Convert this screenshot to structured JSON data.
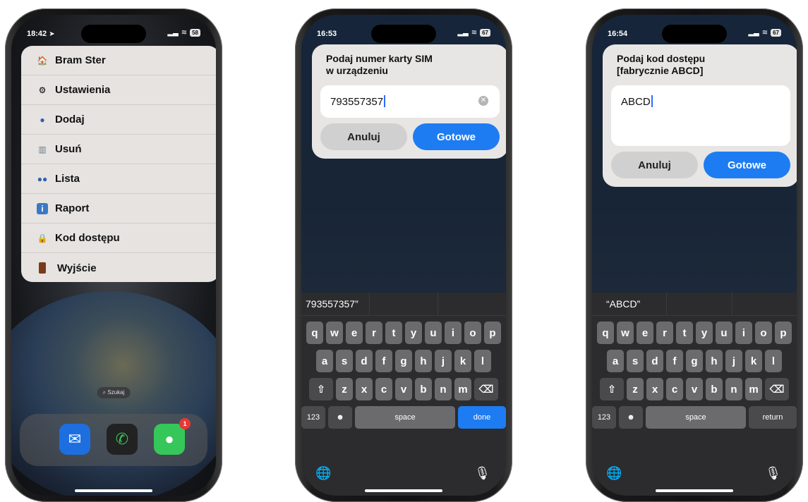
{
  "phones": [
    {
      "status": {
        "time": "18:42",
        "battery": "58"
      },
      "menu": [
        {
          "label": "Bram Ster",
          "icon": "house-icon"
        },
        {
          "label": "Ustawienia",
          "icon": "gear-icon"
        },
        {
          "label": "Dodaj",
          "icon": "person-icon"
        },
        {
          "label": "Usuń",
          "icon": "trash-icon"
        },
        {
          "label": "Lista",
          "icon": "people-icon"
        },
        {
          "label": "Raport",
          "icon": "info-icon"
        },
        {
          "label": "Kod dostępu",
          "icon": "lock-icon"
        },
        {
          "label": "Wyjście",
          "icon": "door-icon"
        }
      ],
      "search": "Szukaj",
      "dock": {
        "badge": "1"
      }
    },
    {
      "status": {
        "time": "16:53",
        "battery": "67"
      },
      "dialog": {
        "title": "Podaj  numer karty SIM\nw urządzeniu",
        "value": "793557357",
        "cancel": "Anuluj",
        "ok": "Gotowe"
      },
      "keyboard": {
        "suggestions": [
          "793557357”",
          "",
          ""
        ],
        "row1": [
          "q",
          "w",
          "e",
          "r",
          "t",
          "y",
          "u",
          "i",
          "o",
          "p"
        ],
        "row2": [
          "a",
          "s",
          "d",
          "f",
          "g",
          "h",
          "j",
          "k",
          "l"
        ],
        "row3": [
          "z",
          "x",
          "c",
          "v",
          "b",
          "n",
          "m"
        ],
        "num": "123",
        "space": "space",
        "action": "done"
      }
    },
    {
      "status": {
        "time": "16:54",
        "battery": "67"
      },
      "dialog": {
        "title": "Podaj kod dostępu\n[fabrycznie ABCD]",
        "value": "ABCD",
        "cancel": "Anuluj",
        "ok": "Gotowe"
      },
      "keyboard": {
        "suggestions": [
          "“ABCD”",
          "",
          ""
        ],
        "row1": [
          "q",
          "w",
          "e",
          "r",
          "t",
          "y",
          "u",
          "i",
          "o",
          "p"
        ],
        "row2": [
          "a",
          "s",
          "d",
          "f",
          "g",
          "h",
          "j",
          "k",
          "l"
        ],
        "row3": [
          "z",
          "x",
          "c",
          "v",
          "b",
          "n",
          "m"
        ],
        "num": "123",
        "space": "space",
        "action": "return"
      }
    }
  ]
}
